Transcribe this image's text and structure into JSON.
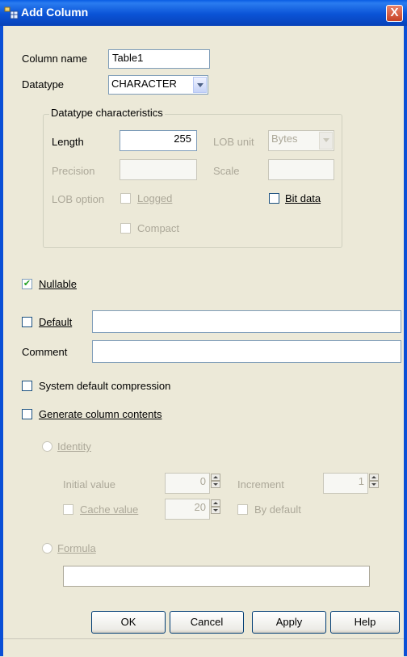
{
  "window": {
    "title": "Add Column",
    "close_glyph": "X",
    "title_icon": "table-column-icon"
  },
  "column_name": {
    "label": "Column name",
    "value": "Table1"
  },
  "datatype": {
    "label": "Datatype",
    "value": "CHARACTER"
  },
  "characteristics": {
    "legend": "Datatype characteristics",
    "length": {
      "label": "Length",
      "value": "255"
    },
    "lob_unit": {
      "label": "LOB unit",
      "value": "Bytes"
    },
    "precision": {
      "label": "Precision",
      "value": ""
    },
    "scale": {
      "label": "Scale",
      "value": ""
    },
    "lob_option": {
      "label": "LOB option"
    },
    "logged": {
      "label": "Logged",
      "checked": false
    },
    "compact": {
      "label": "Compact",
      "checked": false
    },
    "bit_data": {
      "label": "Bit data",
      "checked": false
    }
  },
  "nullable": {
    "label": "Nullable",
    "checked": true
  },
  "default": {
    "label": "Default",
    "checked": false,
    "value": ""
  },
  "comment": {
    "label": "Comment",
    "value": ""
  },
  "system_compression": {
    "label": "System default compression",
    "checked": false
  },
  "generate_contents": {
    "label": "Generate column contents",
    "checked": false
  },
  "identity": {
    "label": "Identity",
    "initial_value": {
      "label": "Initial value",
      "value": "0"
    },
    "increment": {
      "label": "Increment",
      "value": "1"
    },
    "cache_value": {
      "label": "Cache value",
      "checked": false,
      "value": "20"
    },
    "by_default": {
      "label": "By default",
      "checked": false
    }
  },
  "formula": {
    "label": "Formula",
    "value": ""
  },
  "buttons": {
    "ok": "OK",
    "cancel": "Cancel",
    "apply": "Apply",
    "help": "Help"
  },
  "colors": {
    "title_bar": "#0a53d6",
    "dialog_bg": "#ece9d8",
    "disabled_text": "#aca899",
    "check_mark": "#21a121"
  }
}
